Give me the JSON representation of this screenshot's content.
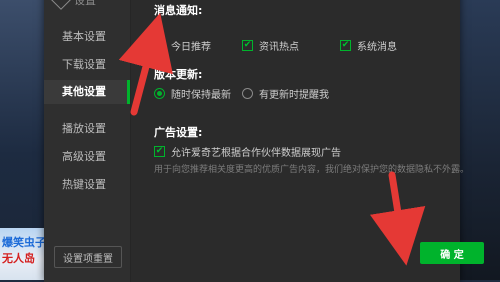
{
  "sidebar": {
    "top_item": "设置",
    "items": [
      {
        "label": "基本设置"
      },
      {
        "label": "下载设置"
      },
      {
        "label": "其他设置"
      },
      {
        "label": "播放设置"
      },
      {
        "label": "高级设置"
      },
      {
        "label": "热键设置"
      }
    ],
    "reset_label": "设置项重置"
  },
  "left_art": {
    "line1": "爆笑虫子",
    "line2": "无人岛"
  },
  "sections": {
    "notify": {
      "title": "消息通知:",
      "options": [
        {
          "label": "今日推荐",
          "checked": false
        },
        {
          "label": "资讯热点",
          "checked": true
        },
        {
          "label": "系统消息",
          "checked": true
        }
      ]
    },
    "update": {
      "title": "版本更新:",
      "options": [
        {
          "label": "随时保持最新",
          "selected": true
        },
        {
          "label": "有更新时提醒我",
          "selected": false
        }
      ]
    },
    "ads": {
      "title": "广告设置:",
      "option_label": "允许爱奇艺根据合作伙伴数据展现广告",
      "hint": "用于向您推荐相关度更高的优质广告内容，我们绝对保护您的数据隐私不外露。"
    }
  },
  "footer": {
    "confirm_label": "确 定"
  },
  "colors": {
    "accent": "#00b32c",
    "panel": "#2b2b2b",
    "annotation": "#e53935"
  }
}
